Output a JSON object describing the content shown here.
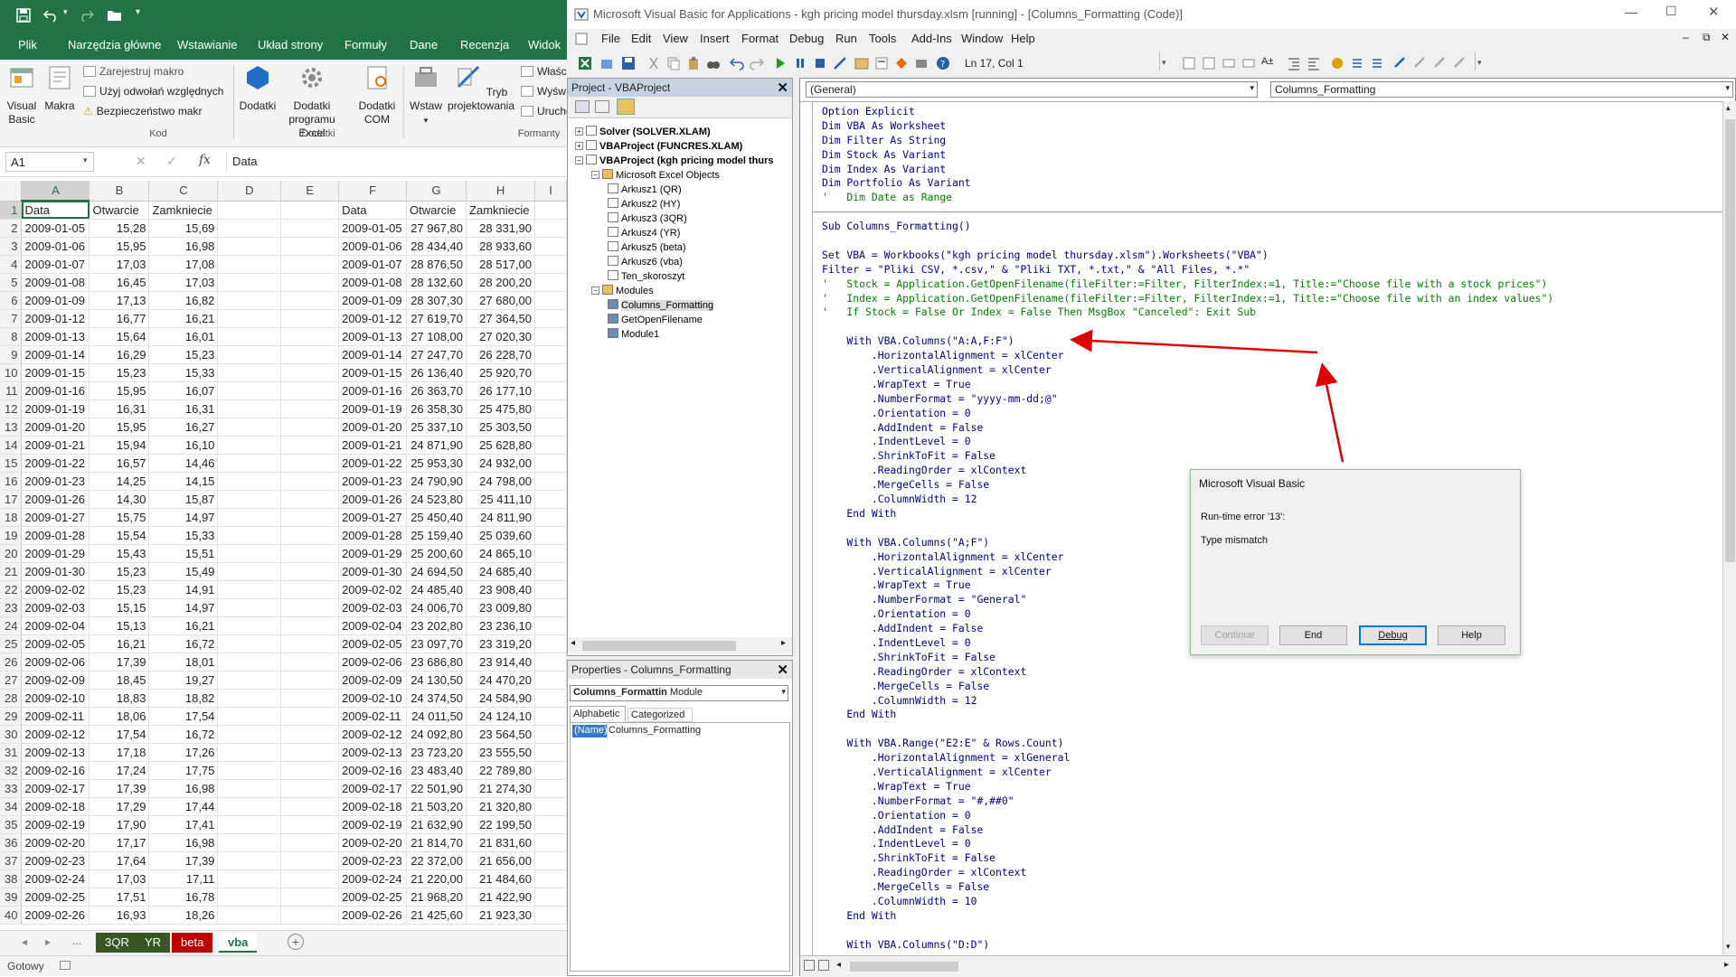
{
  "excel": {
    "ribbon_tabs": [
      "Plik",
      "Narzędzia główne",
      "Wstawianie",
      "Układ strony",
      "Formuły",
      "Dane",
      "Recenzja",
      "Widok"
    ],
    "ribbon": {
      "visual_basic": "Visual Basic",
      "macros": "Makra",
      "record_macro": "Zarejestruj makro",
      "relative_refs": "Użyj odwołań względnych",
      "macro_security": "Bezpieczeństwo makr",
      "group_code": "Kod",
      "addins": "Dodatki",
      "excel_addins": "Dodatki programu Excel",
      "com_addins": "Dodatki COM",
      "group_addins": "Dodatki",
      "insert": "Wstaw",
      "design_mode": "Tryb projektowania",
      "properties": "Właśc",
      "view_code": "Wyśw",
      "run_dialog": "Urucho",
      "group_controls": "Formanty"
    },
    "name_box": "A1",
    "formula": "Data",
    "columns": [
      "A",
      "B",
      "C",
      "D",
      "E",
      "F",
      "G",
      "H",
      "I"
    ],
    "rows": [
      [
        "1",
        "Data",
        "Otwarcie",
        "Zamkniecie",
        "",
        "",
        "Data",
        "Otwarcie",
        "Zamkniecie"
      ],
      [
        "2",
        "2009-01-05",
        "15,28",
        "15,69",
        "",
        "",
        "2009-01-05",
        "27 967,80",
        "28 331,90"
      ],
      [
        "3",
        "2009-01-06",
        "15,95",
        "16,98",
        "",
        "",
        "2009-01-06",
        "28 434,40",
        "28 933,60"
      ],
      [
        "4",
        "2009-01-07",
        "17,03",
        "17,08",
        "",
        "",
        "2009-01-07",
        "28 876,50",
        "28 517,00"
      ],
      [
        "5",
        "2009-01-08",
        "16,45",
        "17,03",
        "",
        "",
        "2009-01-08",
        "28 132,60",
        "28 200,20"
      ],
      [
        "6",
        "2009-01-09",
        "17,13",
        "16,82",
        "",
        "",
        "2009-01-09",
        "28 307,30",
        "27 680,00"
      ],
      [
        "7",
        "2009-01-12",
        "16,77",
        "16,21",
        "",
        "",
        "2009-01-12",
        "27 619,70",
        "27 364,50"
      ],
      [
        "8",
        "2009-01-13",
        "15,64",
        "16,01",
        "",
        "",
        "2009-01-13",
        "27 108,00",
        "27 020,30"
      ],
      [
        "9",
        "2009-01-14",
        "16,29",
        "15,23",
        "",
        "",
        "2009-01-14",
        "27 247,70",
        "26 228,70"
      ],
      [
        "10",
        "2009-01-15",
        "15,23",
        "15,33",
        "",
        "",
        "2009-01-15",
        "26 136,40",
        "25 920,70"
      ],
      [
        "11",
        "2009-01-16",
        "15,95",
        "16,07",
        "",
        "",
        "2009-01-16",
        "26 363,70",
        "26 177,10"
      ],
      [
        "12",
        "2009-01-19",
        "16,31",
        "16,31",
        "",
        "",
        "2009-01-19",
        "26 358,30",
        "25 475,80"
      ],
      [
        "13",
        "2009-01-20",
        "15,95",
        "16,27",
        "",
        "",
        "2009-01-20",
        "25 337,10",
        "25 303,50"
      ],
      [
        "14",
        "2009-01-21",
        "15,94",
        "16,10",
        "",
        "",
        "2009-01-21",
        "24 871,90",
        "25 628,80"
      ],
      [
        "15",
        "2009-01-22",
        "16,57",
        "14,46",
        "",
        "",
        "2009-01-22",
        "25 953,30",
        "24 932,00"
      ],
      [
        "16",
        "2009-01-23",
        "14,25",
        "14,15",
        "",
        "",
        "2009-01-23",
        "24 790,90",
        "24 798,00"
      ],
      [
        "17",
        "2009-01-26",
        "14,30",
        "15,87",
        "",
        "",
        "2009-01-26",
        "24 523,80",
        "25 411,10"
      ],
      [
        "18",
        "2009-01-27",
        "15,75",
        "14,97",
        "",
        "",
        "2009-01-27",
        "25 450,40",
        "24 811,90"
      ],
      [
        "19",
        "2009-01-28",
        "15,54",
        "15,33",
        "",
        "",
        "2009-01-28",
        "25 159,40",
        "25 039,60"
      ],
      [
        "20",
        "2009-01-29",
        "15,43",
        "15,51",
        "",
        "",
        "2009-01-29",
        "25 200,60",
        "24 865,10"
      ],
      [
        "21",
        "2009-01-30",
        "15,23",
        "15,49",
        "",
        "",
        "2009-01-30",
        "24 694,50",
        "24 685,40"
      ],
      [
        "22",
        "2009-02-02",
        "15,23",
        "14,91",
        "",
        "",
        "2009-02-02",
        "24 485,40",
        "23 908,40"
      ],
      [
        "23",
        "2009-02-03",
        "15,15",
        "14,97",
        "",
        "",
        "2009-02-03",
        "24 006,70",
        "23 009,80"
      ],
      [
        "24",
        "2009-02-04",
        "15,13",
        "16,21",
        "",
        "",
        "2009-02-04",
        "23 202,80",
        "23 236,10"
      ],
      [
        "25",
        "2009-02-05",
        "16,21",
        "16,72",
        "",
        "",
        "2009-02-05",
        "23 097,70",
        "23 319,20"
      ],
      [
        "26",
        "2009-02-06",
        "17,39",
        "18,01",
        "",
        "",
        "2009-02-06",
        "23 686,80",
        "23 914,40"
      ],
      [
        "27",
        "2009-02-09",
        "18,45",
        "19,27",
        "",
        "",
        "2009-02-09",
        "24 130,50",
        "24 470,20"
      ],
      [
        "28",
        "2009-02-10",
        "18,83",
        "18,82",
        "",
        "",
        "2009-02-10",
        "24 374,50",
        "24 584,90"
      ],
      [
        "29",
        "2009-02-11",
        "18,06",
        "17,54",
        "",
        "",
        "2009-02-11",
        "24 011,50",
        "24 124,10"
      ],
      [
        "30",
        "2009-02-12",
        "17,54",
        "16,72",
        "",
        "",
        "2009-02-12",
        "24 092,80",
        "23 564,50"
      ],
      [
        "31",
        "2009-02-13",
        "17,18",
        "17,26",
        "",
        "",
        "2009-02-13",
        "23 723,20",
        "23 555,50"
      ],
      [
        "32",
        "2009-02-16",
        "17,24",
        "17,75",
        "",
        "",
        "2009-02-16",
        "23 483,40",
        "22 789,80"
      ],
      [
        "33",
        "2009-02-17",
        "17,39",
        "16,98",
        "",
        "",
        "2009-02-17",
        "22 501,90",
        "21 274,30"
      ],
      [
        "34",
        "2009-02-18",
        "17,29",
        "17,44",
        "",
        "",
        "2009-02-18",
        "21 503,20",
        "21 320,80"
      ],
      [
        "35",
        "2009-02-19",
        "17,90",
        "17,41",
        "",
        "",
        "2009-02-19",
        "21 632,90",
        "22 199,50"
      ],
      [
        "36",
        "2009-02-20",
        "17,17",
        "16,98",
        "",
        "",
        "2009-02-20",
        "21 814,70",
        "21 831,60"
      ],
      [
        "37",
        "2009-02-23",
        "17,64",
        "17,39",
        "",
        "",
        "2009-02-23",
        "22 372,00",
        "21 656,00"
      ],
      [
        "38",
        "2009-02-24",
        "17,03",
        "17,11",
        "",
        "",
        "2009-02-24",
        "21 220,00",
        "21 484,60"
      ],
      [
        "39",
        "2009-02-25",
        "17,51",
        "16,78",
        "",
        "",
        "2009-02-25",
        "21 968,20",
        "21 422,90"
      ],
      [
        "40",
        "2009-02-26",
        "16,93",
        "18,26",
        "",
        "",
        "2009-02-26",
        "21 425,60",
        "21 923,30"
      ]
    ],
    "sheet_tabs": [
      {
        "name": "3QR",
        "color": "#375623"
      },
      {
        "name": "YR",
        "color": "#375623"
      },
      {
        "name": "beta",
        "color": "#c00000"
      },
      {
        "name": "vba",
        "color": "#ffffff"
      }
    ],
    "status": "Gotowy"
  },
  "vbe": {
    "title": "Microsoft Visual Basic for Applications - kgh pricing model thursday.xlsm [running] - [Columns_Formatting (Code)]",
    "menu": [
      "File",
      "Edit",
      "View",
      "Insert",
      "Format",
      "Debug",
      "Run",
      "Tools",
      "Add-Ins",
      "Window",
      "Help"
    ],
    "position": "Ln 17, Col 1",
    "project_title": "Project - VBAProject",
    "tree": [
      {
        "label": "Solver (SOLVER.XLAM)",
        "bold": true,
        "level": 0
      },
      {
        "label": "VBAProject (FUNCRES.XLAM)",
        "bold": true,
        "level": 0
      },
      {
        "label": "VBAProject (kgh pricing model thurs",
        "bold": true,
        "level": 0
      },
      {
        "label": "Microsoft Excel Objects",
        "bold": false,
        "level": 1
      },
      {
        "label": "Arkusz1 (QR)",
        "bold": false,
        "level": 2
      },
      {
        "label": "Arkusz2 (HY)",
        "bold": false,
        "level": 2
      },
      {
        "label": "Arkusz3 (3QR)",
        "bold": false,
        "level": 2
      },
      {
        "label": "Arkusz4 (YR)",
        "bold": false,
        "level": 2
      },
      {
        "label": "Arkusz5 (beta)",
        "bold": false,
        "level": 2
      },
      {
        "label": "Arkusz6 (vba)",
        "bold": false,
        "level": 2
      },
      {
        "label": "Ten_skoroszyt",
        "bold": false,
        "level": 2
      },
      {
        "label": "Modules",
        "bold": false,
        "level": 1
      },
      {
        "label": "Columns_Formatting",
        "bold": false,
        "level": 2
      },
      {
        "label": "GetOpenFilename",
        "bold": false,
        "level": 2
      },
      {
        "label": "Module1",
        "bold": false,
        "level": 2
      }
    ],
    "props_title": "Properties - Columns_Formatting",
    "props_object": "Columns_Formattin",
    "props_type": "Module",
    "props_tabs": [
      "Alphabetic",
      "Categorized"
    ],
    "props_name_key": "(Name)",
    "props_name_val": "Columns_Formatting",
    "combo_left": "(General)",
    "combo_right": "Columns_Formatting",
    "code_declarations": [
      "Option Explicit",
      "Dim VBA As Worksheet",
      "Dim Filter As String",
      "Dim Stock As Variant",
      "Dim Index As Variant",
      "Dim Portfolio As Variant",
      "'   Dim Date as Range"
    ],
    "code_sub": [
      "Sub Columns_Formatting()",
      "",
      "Set VBA = Workbooks(\"kgh pricing model thursday.xlsm\").Worksheets(\"VBA\")",
      "Filter = \"Pliki CSV, *.csv,\" & \"Pliki TXT, *.txt,\" & \"All Files, *.*\"",
      "'   Stock = Application.GetOpenFilename(fileFilter:=Filter, FilterIndex:=1, Title:=\"Choose file with a stock prices\")",
      "'   Index = Application.GetOpenFilename(fileFilter:=Filter, FilterIndex:=1, Title:=\"Choose file with an index values\")",
      "'   If Stock = False Or Index = False Then MsgBox \"Canceled\": Exit Sub",
      "",
      "    With VBA.Columns(\"A:A,F:F\")",
      "        .HorizontalAlignment = xlCenter",
      "        .VerticalAlignment = xlCenter",
      "        .WrapText = True",
      "        .NumberFormat = \"yyyy-mm-dd;@\"",
      "        .Orientation = 0",
      "        .AddIndent = False",
      "        .IndentLevel = 0",
      "        .ShrinkToFit = False",
      "        .ReadingOrder = xlContext",
      "        .MergeCells = False",
      "        .ColumnWidth = 12",
      "    End With",
      "",
      "    With VBA.Columns(\"A;F\")",
      "        .HorizontalAlignment = xlCenter",
      "        .VerticalAlignment = xlCenter",
      "        .WrapText = True",
      "        .NumberFormat = \"General\"",
      "        .Orientation = 0",
      "        .AddIndent = False",
      "        .IndentLevel = 0",
      "        .ShrinkToFit = False",
      "        .ReadingOrder = xlContext",
      "        .MergeCells = False",
      "        .ColumnWidth = 12",
      "    End With",
      "",
      "    With VBA.Range(\"E2:E\" & Rows.Count)",
      "        .HorizontalAlignment = xlGeneral",
      "        .VerticalAlignment = xlCenter",
      "        .WrapText = True",
      "        .NumberFormat = \"#,##0\"",
      "        .Orientation = 0",
      "        .AddIndent = False",
      "        .IndentLevel = 0",
      "        .ShrinkToFit = False",
      "        .ReadingOrder = xlContext",
      "        .MergeCells = False",
      "        .ColumnWidth = 10",
      "    End With",
      "",
      "    With VBA.Columns(\"D:D\")"
    ]
  },
  "dialog": {
    "title": "Microsoft Visual Basic",
    "line1": "Run-time error '13':",
    "line2": "Type mismatch",
    "buttons": [
      "Continue",
      "End",
      "Debug",
      "Help"
    ]
  },
  "colors": {
    "excel_green": "#217346",
    "annotation_red": "#e00000",
    "code_blue": "#00008b",
    "comment_green": "#008000"
  }
}
